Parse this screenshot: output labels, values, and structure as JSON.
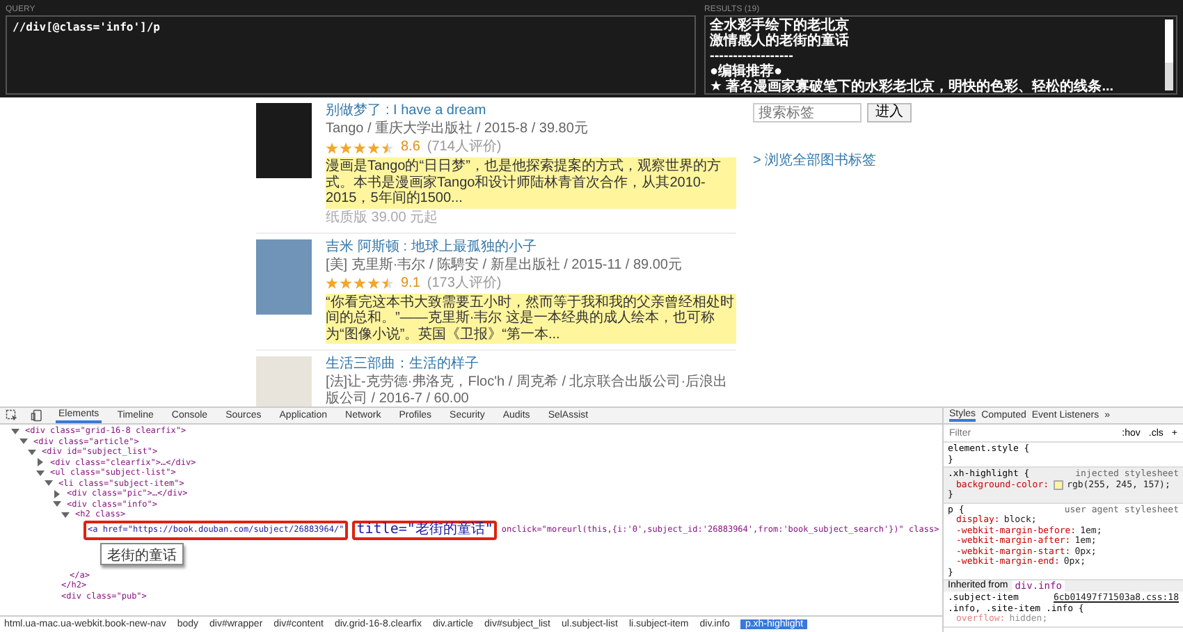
{
  "query": {
    "label": "QUERY",
    "value": "//div[@class='info']/p"
  },
  "results": {
    "label": "RESULTS (19)",
    "lines": [
      "全水彩手绘下的老北京",
      "激情感人的老街的童话",
      "------------------",
      "●编辑推荐●",
      "★ 著名漫画家寡破笔下的水彩老北京，明快的色彩、轻松的线条..."
    ]
  },
  "books": [
    {
      "title": "别做梦了",
      "subtitle": ": I have a dream",
      "pub": "Tango / 重庆大学出版社 / 2015-8 / 39.80元",
      "stars": 4.5,
      "rating": "8.6",
      "votes": "(714人评价)",
      "desc": "漫画是Tango的“日日梦”，也是他探索提案的方式，观察世界的方式。本书是漫画家Tango和设计师陆林青首次合作，从其2010-2015，5年间的1500...",
      "price": "纸质版 39.00 元起"
    },
    {
      "title": "吉米 阿斯顿",
      "subtitle": ": 地球上最孤独的小子",
      "pub": "[美] 克里斯·韦尔 / 陈騁安 / 新星出版社 / 2015-11 / 89.00元",
      "stars": 4.5,
      "rating": "9.1",
      "votes": "(173人评价)",
      "desc": "“你看完这本书大致需要五小时，然而等于我和我的父亲曾经相处时间的总和。”——克里斯·韦尔 这是一本经典的成人绘本，也可称为“图像小说”。英国《卫报》“第一本..."
    },
    {
      "title": "生活三部曲：生活的样子",
      "pub": "[法]让-克劳德·弗洛克，Floc'h / 周克希 / 北京联合出版公司·后浪出版公司 / 2016-7 / 60.00"
    }
  ],
  "tag_search": {
    "placeholder": "搜索标签",
    "button": "进入",
    "link": "> 浏览全部图书标签"
  },
  "devtools": {
    "tabs": [
      {
        "label": "Elements",
        "selected": true
      },
      {
        "label": "Timeline",
        "selected": false
      },
      {
        "label": "Console",
        "selected": false
      },
      {
        "label": "Sources",
        "selected": false
      },
      {
        "label": "Application",
        "selected": false
      },
      {
        "label": "Network",
        "selected": false
      },
      {
        "label": "Profiles",
        "selected": false
      },
      {
        "label": "Security",
        "selected": false
      },
      {
        "label": "Audits",
        "selected": false
      },
      {
        "label": "SelAssist",
        "selected": false
      }
    ],
    "tree": [
      {
        "kind": "element",
        "text": "<div class=\"grid-16-8 clearfix\">",
        "expanded": true,
        "children": [
          {
            "kind": "element",
            "text": "<div class=\"article\">",
            "expanded": true,
            "children": [
              {
                "kind": "element",
                "text": "<div id=\"subject_list\">",
                "expanded": true,
                "children": [
                  {
                    "kind": "element",
                    "text": "<div class=\"clearfix\">…</div>",
                    "expanded": false
                  },
                  {
                    "kind": "element",
                    "text": "<ul class=\"subject-list\">",
                    "expanded": true,
                    "children": [
                      {
                        "kind": "element",
                        "text": "<li class=\"subject-item\">",
                        "expanded": true,
                        "children": [
                          {
                            "kind": "element",
                            "text": "<div class=\"pic\">…</div>",
                            "expanded": false
                          },
                          {
                            "kind": "element",
                            "text": "<div class=\"info\">",
                            "expanded": true,
                            "children": [
                              {
                                "kind": "element",
                                "text": "<h2 class>",
                                "expanded": true,
                                "children": [
                                  {
                                    "kind": "parts",
                                    "parts": [
                                      {
                                        "text": "<a href=\"https://book.douban.com/subject/26883964/\"",
                                        "boxed": true
                                      },
                                      {
                                        "text": "title=\"老街的童话\"",
                                        "boxed": true
                                      },
                                      {
                                        "text": "onclick=\"moreurl(this,{i:'0',subject_id:'26883964',from:'book_subject_search'})\" class>",
                                        "boxed": false
                                      }
                                    ],
                                    "children": [
                                      {
                                        "kind": "note",
                                        "text": "老街的童话"
                                      }
                                    ]
                                  },
                                  {
                                    "kind": "close",
                                    "text": "</a>"
                                  }
                                ]
                              },
                              {
                                "kind": "close",
                                "text": "</h2>"
                              },
                              {
                                "kind": "close",
                                "text": "<div class=\"pub\">"
                              }
                            ]
                          }
                        ]
                      }
                    ]
                  }
                ]
              }
            ]
          }
        ]
      }
    ],
    "breadcrumbs": [
      {
        "label": "html.ua-mac.ua-webkit.book-new-nav",
        "selected": false
      },
      {
        "label": "body",
        "selected": false
      },
      {
        "label": "div#wrapper",
        "selected": false
      },
      {
        "label": "div#content",
        "selected": false
      },
      {
        "label": "div.grid-16-8.clearfix",
        "selected": false
      },
      {
        "label": "div.article",
        "selected": false
      },
      {
        "label": "div#subject_list",
        "selected": false
      },
      {
        "label": "ul.subject-list",
        "selected": false
      },
      {
        "label": "li.subject-item",
        "selected": false
      },
      {
        "label": "div.info",
        "selected": false
      },
      {
        "label": "p.xh-highlight",
        "selected": true
      }
    ],
    "styles": {
      "tabs": [
        {
          "label": "Styles",
          "selected": true
        },
        {
          "label": "Computed",
          "selected": false
        },
        {
          "label": "Event Listeners",
          "selected": false
        },
        {
          "label": "»",
          "selected": false
        }
      ],
      "filter_placeholder": "Filter",
      "hov": ":hov",
      "cls": ".cls",
      "add": "+",
      "rules": [
        {
          "selector": "element.style {",
          "shaded": false,
          "close": "}"
        },
        {
          "selector": ".xh-highlight {",
          "source": "injected stylesheet",
          "shaded": true,
          "props": [
            {
              "name": "background-color:",
              "value": "rgb(255, 245, 157);",
              "swatch": true
            }
          ],
          "close": "}"
        },
        {
          "selector": "p {",
          "source": "user agent stylesheet",
          "shaded": false,
          "props": [
            {
              "name": "display:",
              "value": "block;"
            },
            {
              "name": "-webkit-margin-before:",
              "value": "1em;"
            },
            {
              "name": "-webkit-margin-after:",
              "value": "1em;"
            },
            {
              "name": "-webkit-margin-start:",
              "value": "0px;"
            },
            {
              "name": "-webkit-margin-end:",
              "value": "0px;"
            }
          ],
          "close": "}"
        }
      ],
      "inherited_label": "Inherited from",
      "inherited_from": "div.info",
      "inherited_rule": {
        "selector": ".subject-item",
        "source": "6cb01497f71503a8.css:18",
        "selector2": ".info, .site-item .info {",
        "props": [
          {
            "name": "overflow:",
            "value": "hidden;"
          }
        ]
      }
    }
  }
}
